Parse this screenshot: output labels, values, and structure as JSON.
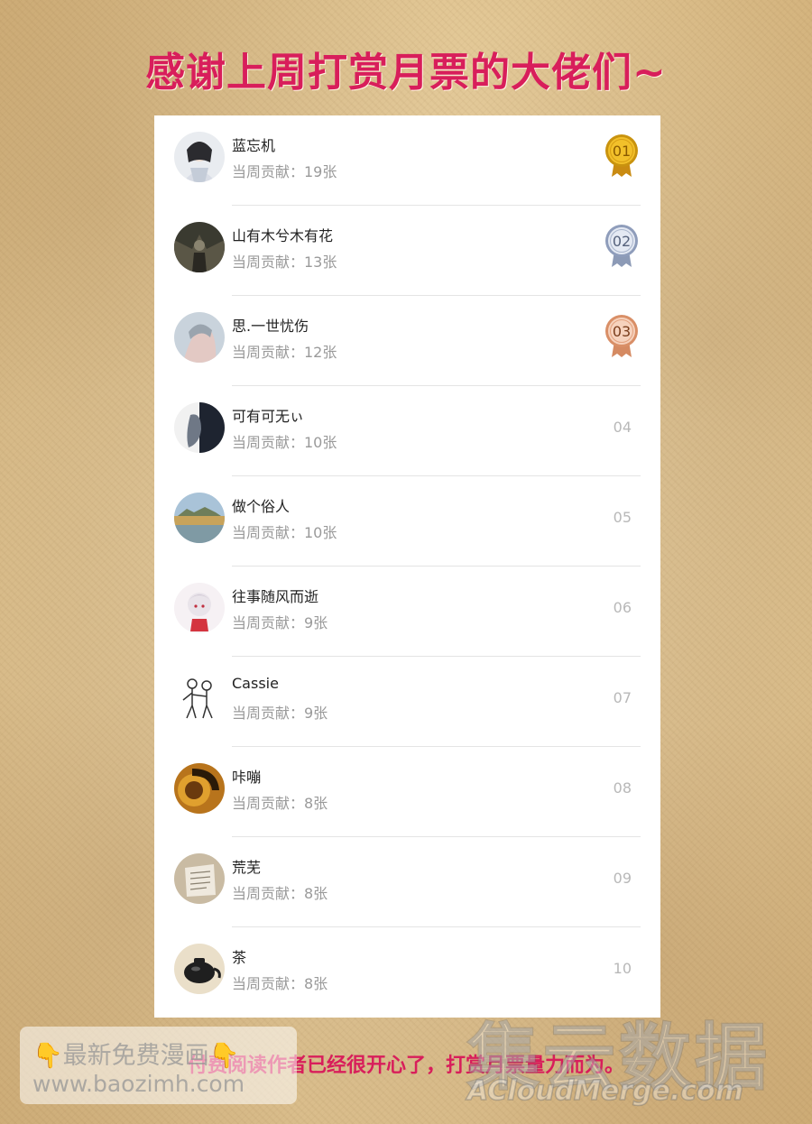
{
  "title": "感谢上周打赏月票的大佬们~",
  "entries": [
    {
      "name": "蓝忘机",
      "contribution": "当周贡献：19张",
      "rank": "01"
    },
    {
      "name": "山有木兮木有花",
      "contribution": "当周贡献：13张",
      "rank": "02"
    },
    {
      "name": "思.一世忧伤",
      "contribution": "当周贡献：12张",
      "rank": "03"
    },
    {
      "name": "可有可无ぃ",
      "contribution": "当周贡献：10张",
      "rank": "04"
    },
    {
      "name": "做个俗人",
      "contribution": "当周贡献：10张",
      "rank": "05"
    },
    {
      "name": "往事随风而逝",
      "contribution": "当周贡献：9张",
      "rank": "06"
    },
    {
      "name": "Cassie",
      "contribution": "当周贡献：9张",
      "rank": "07"
    },
    {
      "name": "咔嘣",
      "contribution": "当周贡献：8张",
      "rank": "08"
    },
    {
      "name": "荒芜",
      "contribution": "当周贡献：8张",
      "rank": "09"
    },
    {
      "name": "茶",
      "contribution": "当周贡献：8张",
      "rank": "10"
    }
  ],
  "footer_note": "付费阅读作者已经很开心了，打赏月票量力而为。",
  "watermark_left": {
    "line1": "最新免费漫画",
    "line2": "www.baozimh.com"
  },
  "watermark_right": {
    "logo": "集云数据",
    "url": "ACloudMerge.com"
  },
  "colors": {
    "accent": "#d81e5b",
    "gold": "#e8b21a",
    "silver": "#9aa9c7",
    "bronze": "#e79a74"
  }
}
